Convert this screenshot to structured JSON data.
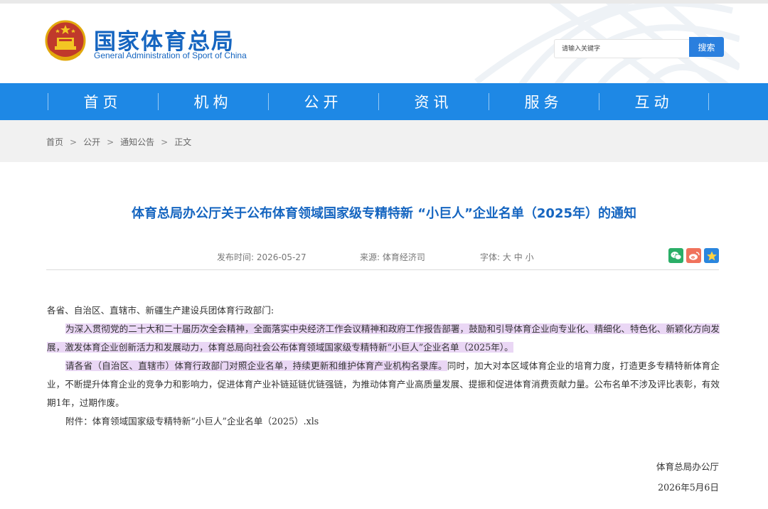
{
  "header": {
    "site_name_cn": "国家体育总局",
    "site_name_en": "General Administration of Sport of China",
    "search_placeholder": "请输入关键字",
    "search_button": "搜索",
    "emblem_icon": "national-emblem-icon",
    "background_graphic": "stadium-lattice"
  },
  "nav": {
    "items": [
      {
        "label": "首页"
      },
      {
        "label": "机构"
      },
      {
        "label": "公开"
      },
      {
        "label": "资讯"
      },
      {
        "label": "服务"
      },
      {
        "label": "互动"
      }
    ]
  },
  "breadcrumb": {
    "items": [
      "首页",
      "公开",
      "通知公告",
      "正文"
    ],
    "separator": ">"
  },
  "article": {
    "title": "体育总局办公厅关于公布体育领域国家级专精特新 “小巨人”企业名单（2025年）的通知",
    "publish_label": "发布时间:",
    "publish_date": "2026-05-27",
    "source_label": "来源:",
    "source": "体育经济司",
    "font_label": "字体:",
    "font_sizes": [
      "大",
      "中",
      "小"
    ],
    "share_icons": [
      "wechat-icon",
      "weibo-icon",
      "favorite-icon"
    ],
    "salutation": "各省、自治区、直辖市、新疆生产建设兵团体育行政部门:",
    "para1": "为深入贯彻党的二十大和二十届历次全会精神，全面落实中央经济工作会议精神和政府工作报告部署，鼓励和引导体育企业向专业化、精细化、特色化、新颖化方向发展，激发体育企业创新活力和发展动力，体育总局向社会公布体育领域国家级专精特新“小巨人”企业名单（2025年）。",
    "para2_highlight": "请各省（自治区、直辖市）体育行政部门对照企业名单，持续更新和维护体育产业机构名录库。",
    "para2_rest": "同时，加大对本区域体育企业的培育力度，打造更多专精特新体育企业，不断提升体育企业的竞争力和影响力，促进体育产业补链延链优链强链，为推动体育产业高质量发展、提振和促进体育消费贡献力量。公布名单不涉及评比表彰，有效期1年，过期作废。",
    "attachment": "附件：体育领域国家级专精特新“小巨人”企业名单（2025）.xls",
    "signature": "体育总局办公厅",
    "sign_date": "2026年5月6日"
  },
  "colors": {
    "brand_blue": "#1565c0",
    "nav_blue": "#1e88e5",
    "search_button": "#2a7fde",
    "highlight": "#ead7f5",
    "wechat": "#2aae67",
    "weibo": "#f0725c",
    "favorite": "#2a86de"
  }
}
